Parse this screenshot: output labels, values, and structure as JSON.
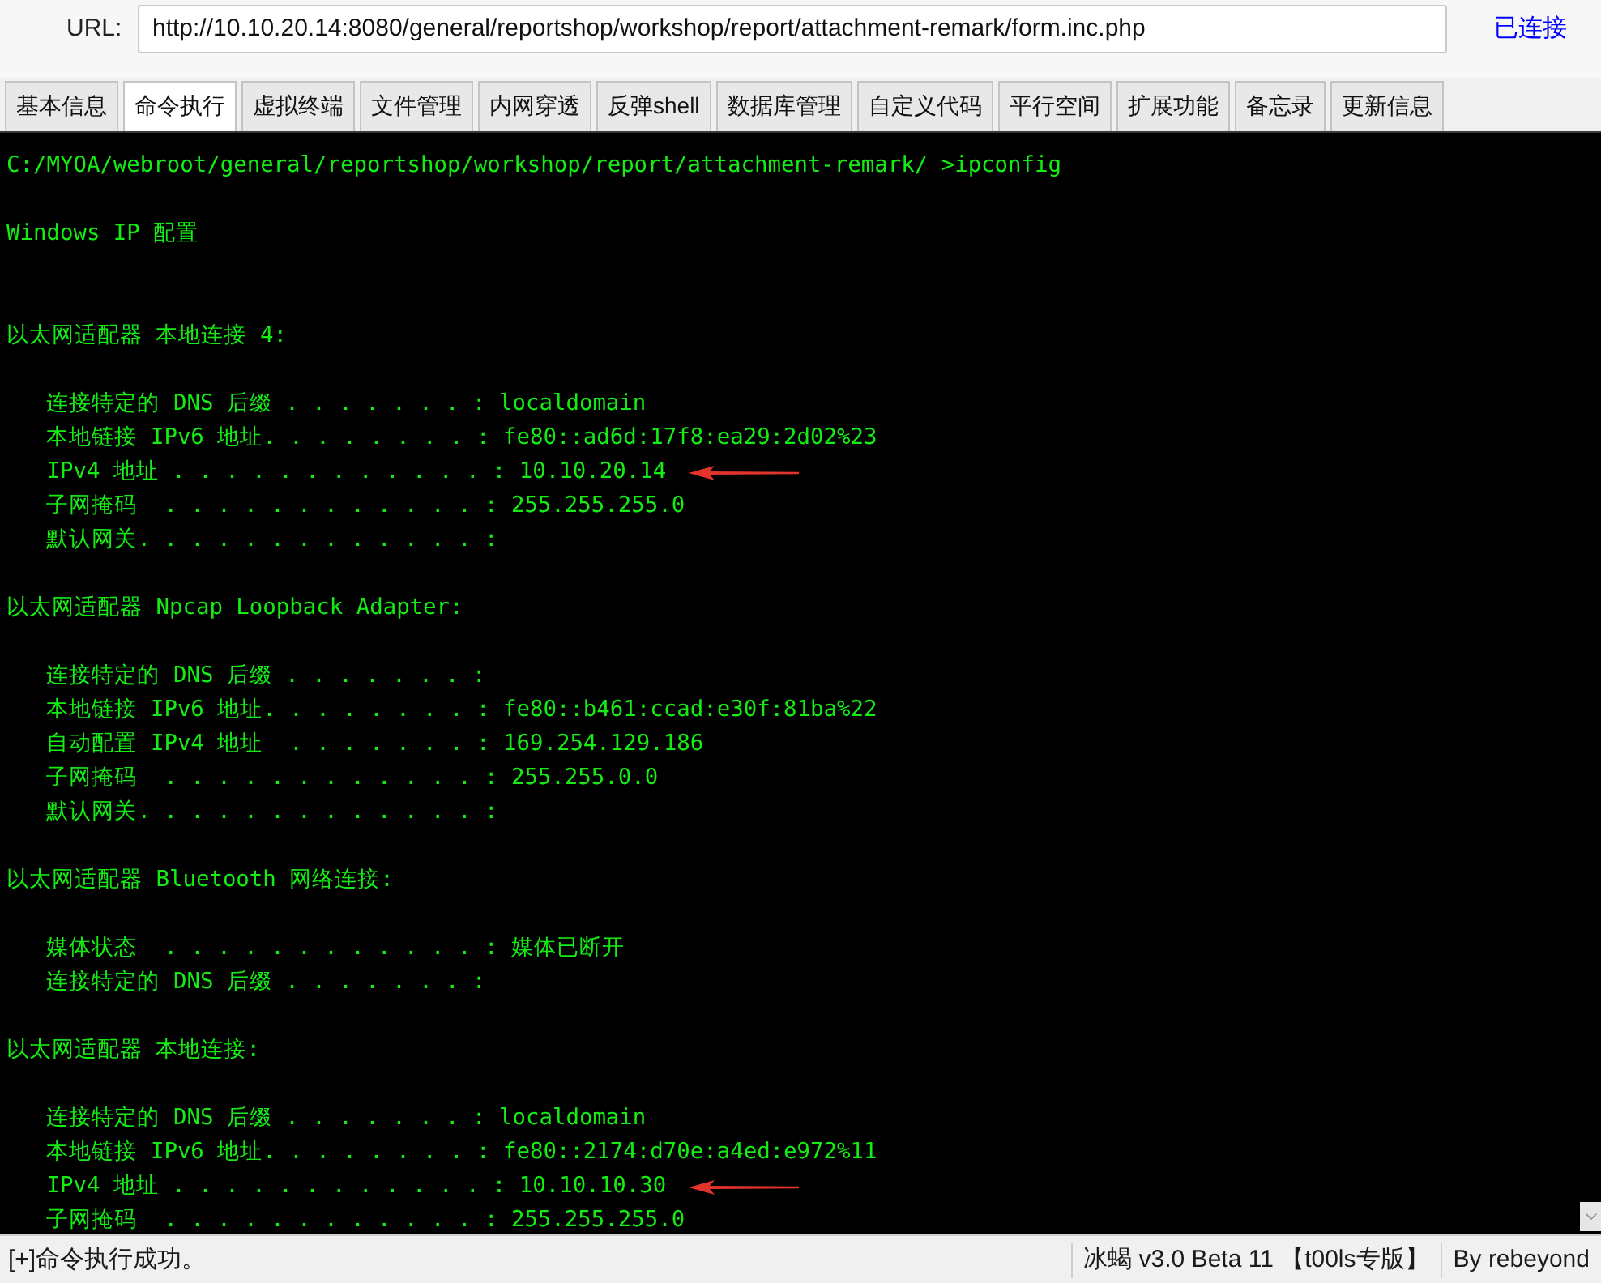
{
  "connection_bar": {
    "label": "URL:",
    "url": "http://10.10.20.14:8080/general/reportshop/workshop/report/attachment-remark/form.inc.php",
    "status": "已连接"
  },
  "tabs": [
    {
      "label": "基本信息",
      "selected": false
    },
    {
      "label": "命令执行",
      "selected": true
    },
    {
      "label": "虚拟终端",
      "selected": false
    },
    {
      "label": "文件管理",
      "selected": false
    },
    {
      "label": "内网穿透",
      "selected": false
    },
    {
      "label": "反弹shell",
      "selected": false
    },
    {
      "label": "数据库管理",
      "selected": false
    },
    {
      "label": "自定义代码",
      "selected": false
    },
    {
      "label": "平行空间",
      "selected": false
    },
    {
      "label": "扩展功能",
      "selected": false
    },
    {
      "label": "备忘录",
      "selected": false
    },
    {
      "label": "更新信息",
      "selected": false
    }
  ],
  "terminal": {
    "command_line": "C:/MYOA/webroot/general/reportshop/workshop/report/attachment-remark/ >ipconfig",
    "title": "Windows IP 配置",
    "adapters": [
      {
        "heading": "以太网适配器 本地连接 4:",
        "entries": [
          {
            "text": "连接特定的 DNS 后缀 . . . . . . . : localdomain",
            "marked": false
          },
          {
            "text": "本地链接 IPv6 地址. . . . . . . . : fe80::ad6d:17f8:ea29:2d02%23",
            "marked": false
          },
          {
            "text": "IPv4 地址 . . . . . . . . . . . . : 10.10.20.14",
            "marked": true
          },
          {
            "text": "子网掩码  . . . . . . . . . . . . : 255.255.255.0",
            "marked": false
          },
          {
            "text": "默认网关. . . . . . . . . . . . . :",
            "marked": false
          }
        ]
      },
      {
        "heading": "以太网适配器 Npcap Loopback Adapter:",
        "entries": [
          {
            "text": "连接特定的 DNS 后缀 . . . . . . . :",
            "marked": false
          },
          {
            "text": "本地链接 IPv6 地址. . . . . . . . : fe80::b461:ccad:e30f:81ba%22",
            "marked": false
          },
          {
            "text": "自动配置 IPv4 地址  . . . . . . . : 169.254.129.186",
            "marked": false
          },
          {
            "text": "子网掩码  . . . . . . . . . . . . : 255.255.0.0",
            "marked": false
          },
          {
            "text": "默认网关. . . . . . . . . . . . . :",
            "marked": false
          }
        ]
      },
      {
        "heading": "以太网适配器 Bluetooth 网络连接:",
        "entries": [
          {
            "text": "媒体状态  . . . . . . . . . . . . : 媒体已断开",
            "marked": false
          },
          {
            "text": "连接特定的 DNS 后缀 . . . . . . . :",
            "marked": false
          }
        ]
      },
      {
        "heading": "以太网适配器 本地连接:",
        "entries": [
          {
            "text": "连接特定的 DNS 后缀 . . . . . . . : localdomain",
            "marked": false
          },
          {
            "text": "本地链接 IPv6 地址. . . . . . . . : fe80::2174:d70e:a4ed:e972%11",
            "marked": false
          },
          {
            "text": "IPv4 地址 . . . . . . . . . . . . : 10.10.10.30",
            "marked": true
          },
          {
            "text": "子网掩码  . . . . . . . . . . . . : 255.255.255.0",
            "marked": false
          }
        ]
      }
    ]
  },
  "status_bar": {
    "message": "[+]命令执行成功。",
    "product": "冰蝎 v3.0 Beta 11 【t00ls专版】",
    "author": "By rebeyond"
  }
}
